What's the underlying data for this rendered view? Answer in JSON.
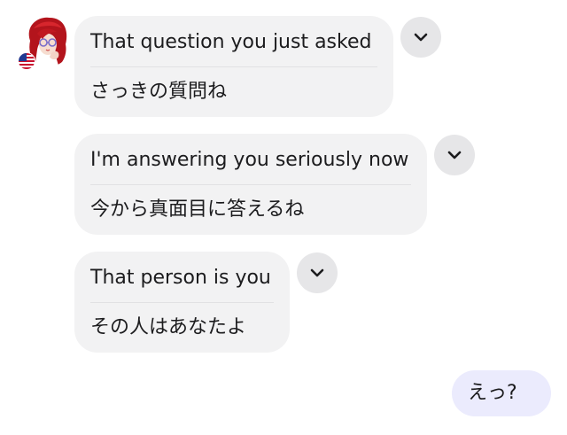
{
  "colors": {
    "incoming_bubble": "#f2f2f3",
    "outgoing_bubble": "#ebebfd",
    "chevron_button": "#e6e6e8",
    "text": "#1c1c1e",
    "separator": "#e1e1e3"
  },
  "sender": {
    "avatar_icon": "avatar-icon",
    "flag_icon": "us-flag-icon"
  },
  "messages": [
    {
      "original": "That question you just asked",
      "translation": "さっきの質問ね",
      "menu_icon": "chevron-down-icon"
    },
    {
      "original": "I'm answering you seriously now",
      "translation": "今から真面目に答えるね",
      "menu_icon": "chevron-down-icon"
    },
    {
      "original": "That person is you",
      "translation": "その人はあなたよ",
      "menu_icon": "chevron-down-icon"
    }
  ],
  "reply": {
    "text": "えっ?"
  }
}
